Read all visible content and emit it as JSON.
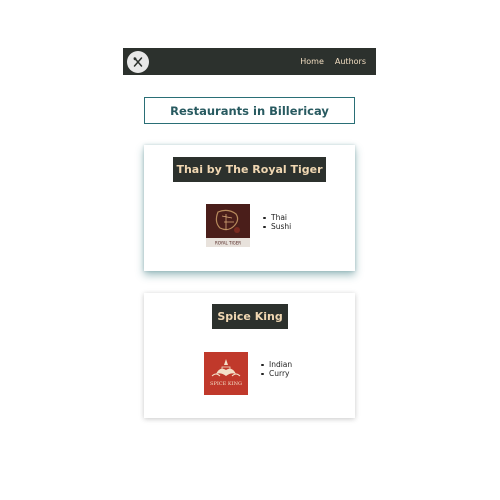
{
  "nav": {
    "logo_icon": "fork-knife-icon",
    "links": [
      "Home",
      "Authors"
    ]
  },
  "page": {
    "title": "Restaurants in Billericay"
  },
  "restaurants": [
    {
      "name": "Thai by The Royal Tiger",
      "logo_text": "ROYAL TIGER",
      "tags": [
        "Thai",
        "Sushi"
      ]
    },
    {
      "name": "Spice King",
      "logo_text": "SPICE KING",
      "tags": [
        "Indian",
        "Curry"
      ]
    }
  ],
  "colors": {
    "navbar_bg": "#2c312d",
    "accent": "#2a6f76",
    "name_text": "#f0d7b2"
  }
}
